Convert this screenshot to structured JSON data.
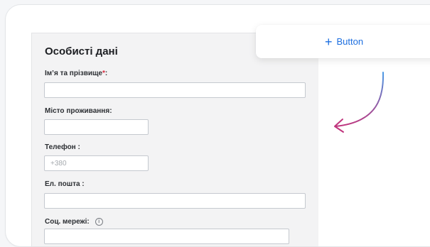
{
  "add_button": {
    "label": "Button",
    "icon": "plus-icon"
  },
  "form": {
    "title": "Особисті дані",
    "fields": [
      {
        "label": "Ім’я та прізвище",
        "required_mark": "*",
        "suffix": ":",
        "value": "",
        "placeholder": ""
      },
      {
        "label": "Місто проживання",
        "suffix": ":",
        "value": "",
        "placeholder": ""
      },
      {
        "label": "Телефон",
        "suffix": " :",
        "value": "",
        "placeholder": "+380"
      },
      {
        "label": "Ел. пошта",
        "suffix": " :",
        "value": "",
        "placeholder": ""
      },
      {
        "label": "Соц. мережі",
        "suffix": ":",
        "icon": "info-icon",
        "value": "",
        "placeholder": ""
      }
    ]
  },
  "colors": {
    "accent": "#1d6fe0",
    "required": "#d6283c",
    "arrow_gradient_start": "#4a9ae6",
    "arrow_gradient_end": "#c0357d"
  }
}
